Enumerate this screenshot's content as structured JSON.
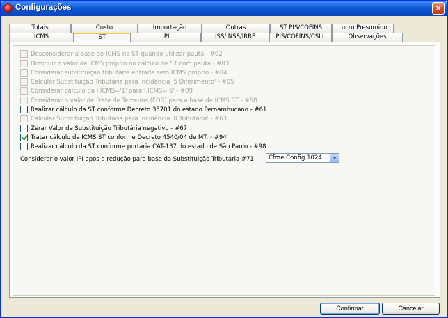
{
  "window": {
    "title": "Configurações"
  },
  "tabs_row1": [
    {
      "label": "Totais"
    },
    {
      "label": "Custo"
    },
    {
      "label": "Importação"
    },
    {
      "label": "Outras"
    },
    {
      "label": "ST PIS/COFINS"
    },
    {
      "label": "Lucro Presumido"
    }
  ],
  "tabs_row2": [
    {
      "label": "ICMS"
    },
    {
      "label": "ST",
      "active": true
    },
    {
      "label": "IPI"
    },
    {
      "label": "ISS/INSS/IRRF"
    },
    {
      "label": "PIS/COFINS/CSLL"
    },
    {
      "label": "Observações"
    }
  ],
  "options": [
    {
      "label": "Desconsiderar a base de ICMS na ST quando utilizar pauta - #02",
      "checked": false,
      "enabled": false
    },
    {
      "label": "Diminuir o valor de ICMS próprio no cálculo de ST com pauta - #03",
      "checked": false,
      "enabled": false
    },
    {
      "label": "Considerar substituição tributária entrada sem ICMS próprio - #04",
      "checked": false,
      "enabled": false
    },
    {
      "label": "Calcular Substituição Tributária para incidência '5 Diferimento' - #05",
      "checked": false,
      "enabled": false
    },
    {
      "label": "Considerar cálculo da I.ICMS='1' para I.ICMS='6' - #09",
      "checked": false,
      "enabled": false
    },
    {
      "label": "Considerar o valor de Frete de Terceiros (FOB) para a base de ICMS ST - #58",
      "checked": false,
      "enabled": false
    },
    {
      "label": "Realizar cálculo da ST conforme Decreto 35701 do estado Pernambucano - #61",
      "checked": false,
      "enabled": true
    },
    {
      "label": "Calcular Substituição Tributária para incidência '0 Tributada' - #63",
      "checked": false,
      "enabled": false
    },
    {
      "label": "Zerar Valor de Substituição Tributária negativo - #67",
      "checked": false,
      "enabled": true
    },
    {
      "label": "Tratar cálculo de ICMS ST conforme Decreto 4540/04 de MT. - #94'",
      "checked": true,
      "enabled": true
    },
    {
      "label": "Realizar cálculo da ST conforme portaria CAT-137 do estado de São Paulo - #98",
      "checked": false,
      "enabled": true
    }
  ],
  "ipi": {
    "label": "Considerar o valor IPI após a redução para base da Substituição Tributária #71",
    "selected": "Cfme Config 1024"
  },
  "buttons": {
    "confirm": "Confirmar",
    "cancel": "Cancelar"
  }
}
